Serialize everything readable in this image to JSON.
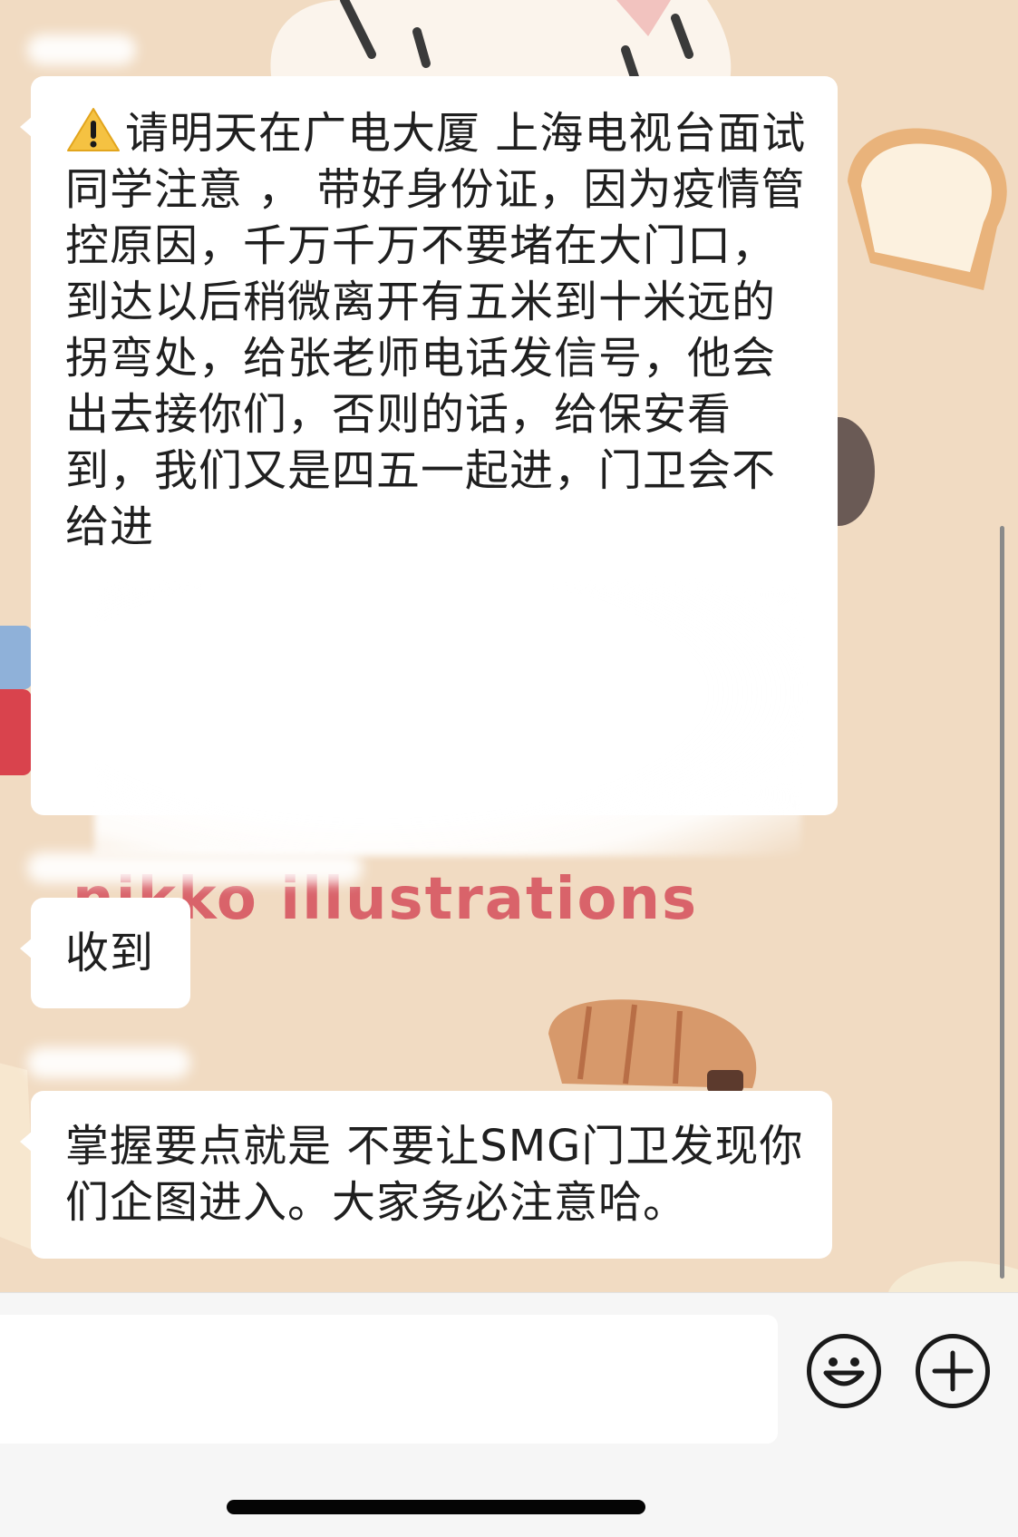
{
  "messages": [
    {
      "id": "msg1",
      "icon": "warning-icon",
      "text": "请明天在广电大厦 上海电视台面试同学注意 ， 带好身份证，因为疫情管控原因，千万千万不要堵在大门口，到达以后稍微离开有五米到十米远的拐弯处，给张老师电话发信号，他会出去接你们，否则的话，给保安看到，我们又是四五一起进，门卫会不给进"
    },
    {
      "id": "msg2",
      "text": "收到"
    },
    {
      "id": "msg3",
      "text": "掌握要点就是 不要让SMG门卫发现你们企图进入。大家务必注意哈。"
    }
  ],
  "wallpaper": {
    "watermark": "nikko illustrations"
  },
  "input_bar": {
    "emoji_icon": "emoji-icon",
    "add_icon": "plus-circle-icon"
  },
  "colors": {
    "bubble": "#ffffff",
    "background": "#f1dbc2",
    "watermark": "#d9636a"
  }
}
